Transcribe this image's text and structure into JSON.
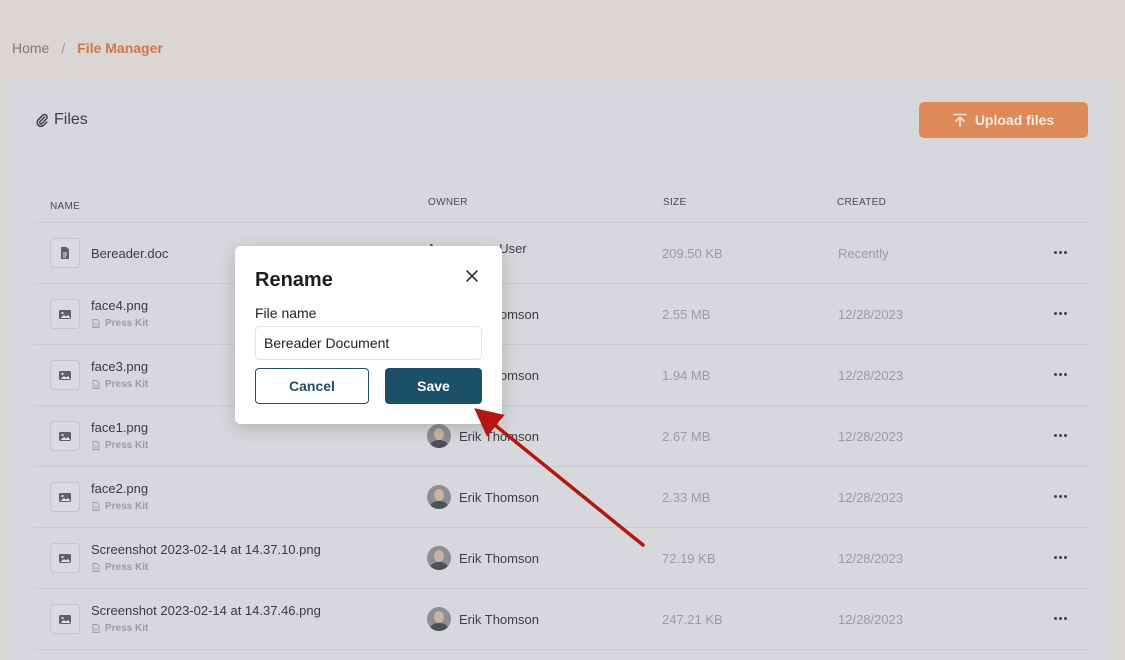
{
  "breadcrumb": {
    "home": "Home",
    "separator": "/",
    "current": "File Manager"
  },
  "card": {
    "title": "Files",
    "title_icon": "paperclip-icon",
    "upload_label": "Upload files",
    "upload_icon": "upload-arrow-icon"
  },
  "table": {
    "headers": {
      "name": "NAME",
      "owner": "OWNER",
      "size": "SIZE",
      "created": "CREATED"
    },
    "rows": [
      {
        "name": "Bereader.doc",
        "folder": "",
        "owner": "Anonymous User",
        "size": "209.50 KB",
        "created": "Recently",
        "icon": "document-icon",
        "avatar": false
      },
      {
        "name": "face4.png",
        "folder": "Press Kit",
        "owner": "Erik Thomson",
        "size": "2.55 MB",
        "created": "12/28/2023",
        "icon": "image-icon",
        "avatar": true
      },
      {
        "name": "face3.png",
        "folder": "Press Kit",
        "owner": "Erik Thomson",
        "size": "1.94 MB",
        "created": "12/28/2023",
        "icon": "image-icon",
        "avatar": true
      },
      {
        "name": "face1.png",
        "folder": "Press Kit",
        "owner": "Erik Thomson",
        "size": "2.67 MB",
        "created": "12/28/2023",
        "icon": "image-icon",
        "avatar": true
      },
      {
        "name": "face2.png",
        "folder": "Press Kit",
        "owner": "Erik Thomson",
        "size": "2.33 MB",
        "created": "12/28/2023",
        "icon": "image-icon",
        "avatar": true
      },
      {
        "name": "Screenshot 2023-02-14 at 14.37.10.png",
        "folder": "Press Kit",
        "owner": "Erik Thomson",
        "size": "72.19 KB",
        "created": "12/28/2023",
        "icon": "image-icon",
        "avatar": true
      },
      {
        "name": "Screenshot 2023-02-14 at 14.37.46.png",
        "folder": "Press Kit",
        "owner": "Erik Thomson",
        "size": "247.21 KB",
        "created": "12/28/2023",
        "icon": "image-icon",
        "avatar": true
      }
    ]
  },
  "modal": {
    "title": "Rename",
    "label": "File name",
    "input_value": "Bereader Document",
    "cancel_label": "Cancel",
    "save_label": "Save"
  },
  "colors": {
    "accent": "#dc8a58",
    "primary": "#1c4f68",
    "breadcrumb_current": "#d2754a",
    "annotation_arrow": "#b3170f"
  }
}
